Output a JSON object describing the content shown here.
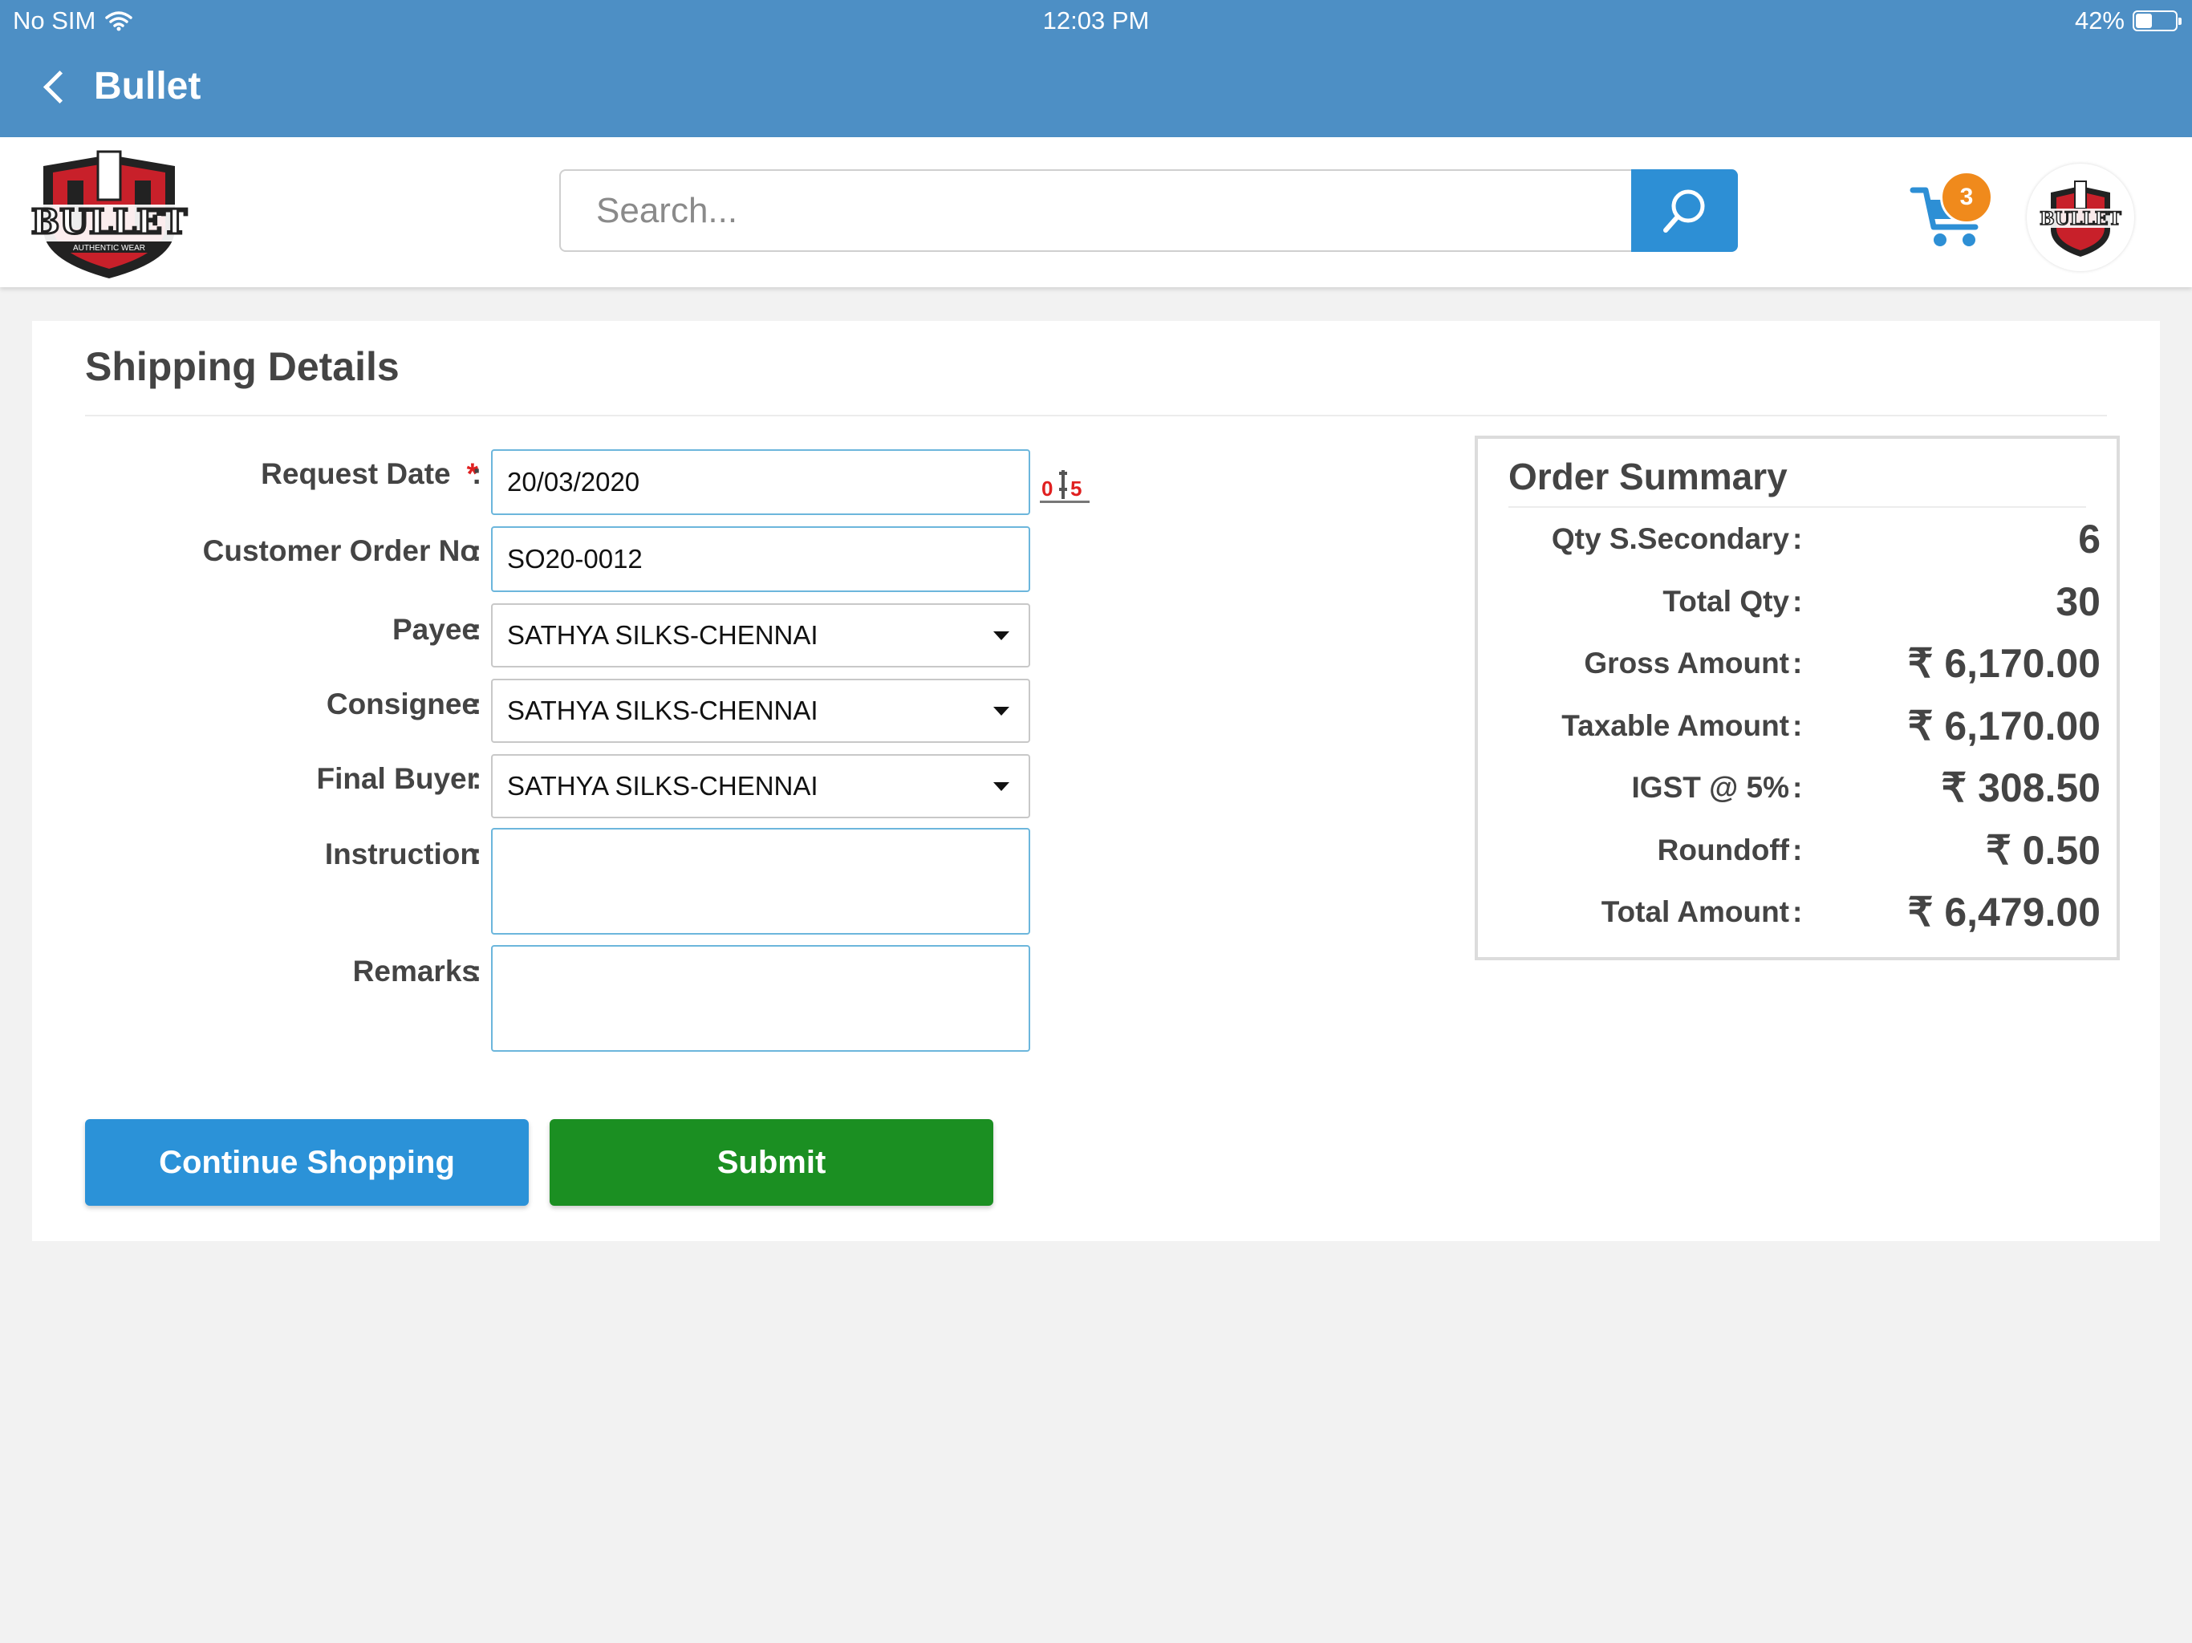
{
  "status_bar": {
    "carrier": "No SIM",
    "time": "12:03 PM",
    "battery": "42%",
    "battery_level": 0.42
  },
  "nav": {
    "title": "Bullet"
  },
  "brand": {
    "logo_text": "BULLET",
    "logo_tagline": "AUTHENTIC WEAR"
  },
  "search": {
    "placeholder": "Search..."
  },
  "cart": {
    "count": "3"
  },
  "colors": {
    "accent": "#4d8fc5",
    "search_button": "#2d8fd5",
    "continue_button": "#2b92d8",
    "submit_button": "#1b8f22",
    "badge": "#f08a1c",
    "required": "#e02020"
  },
  "form": {
    "title": "Shipping Details",
    "fields": {
      "request_date": {
        "label": "Request Date",
        "required": "*",
        "colon": ":",
        "value": "20/03/2020"
      },
      "customer_order_no": {
        "label": "Customer Order No",
        "colon": ":",
        "value": "SO20-0012"
      },
      "payee": {
        "label": "Payee",
        "colon": ":",
        "value": "SATHYA SILKS-CHENNAI"
      },
      "consignee": {
        "label": "Consignee",
        "colon": ":",
        "value": "SATHYA SILKS-CHENNAI"
      },
      "final_buyer": {
        "label": "Final Buyer",
        "colon": ":",
        "value": "SATHYA SILKS-CHENNAI"
      },
      "instruction": {
        "label": "Instruction",
        "colon": ":",
        "value": ""
      },
      "remarks": {
        "label": "Remarks",
        "colon": ":",
        "value": ""
      }
    },
    "calendar_icon": {
      "left": "0",
      "right": "5"
    },
    "buttons": {
      "continue": "Continue Shopping",
      "submit": "Submit"
    }
  },
  "summary": {
    "title": "Order Summary",
    "rows": [
      {
        "label": "Qty S.Secondary",
        "colon": ":",
        "value": "6"
      },
      {
        "label": "Total Qty",
        "colon": ":",
        "value": "30"
      },
      {
        "label": "Gross Amount",
        "colon": ":",
        "value": "₹ 6,170.00"
      },
      {
        "label": "Taxable Amount",
        "colon": ":",
        "value": "₹ 6,170.00"
      },
      {
        "label": "IGST @ 5%",
        "colon": ":",
        "value": "₹ 308.50"
      },
      {
        "label": "Roundoff",
        "colon": ":",
        "value": "₹ 0.50"
      },
      {
        "label": "Total Amount",
        "colon": ":",
        "value": "₹ 6,479.00"
      }
    ]
  }
}
